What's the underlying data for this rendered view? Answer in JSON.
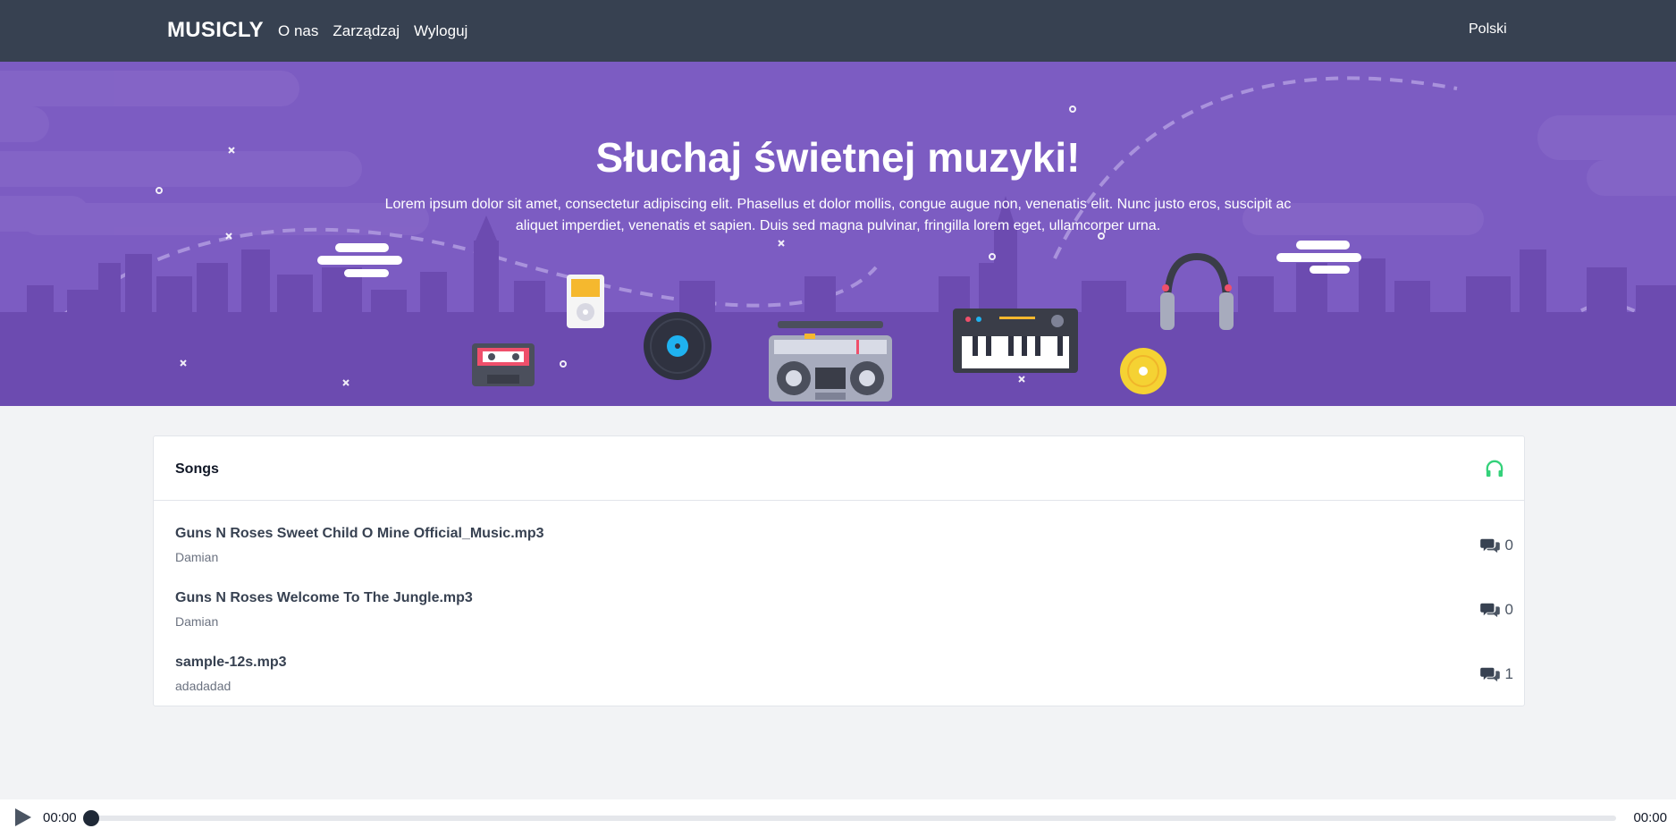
{
  "nav": {
    "brand": "MUSICLY",
    "links": [
      "O nas",
      "Zarządzaj",
      "Wyloguj"
    ],
    "language": "Polski"
  },
  "hero": {
    "title": "Słuchaj świetnej muzyki!",
    "subtitle": "Lorem ipsum dolor sit amet, consectetur adipiscing elit. Phasellus et dolor mollis, congue augue non, venenatis elit. Nunc justo eros, suscipit ac aliquet imperdiet, venenatis et sapien. Duis sed magna pulvinar, fringilla lorem eget, ullamcorper urna."
  },
  "songs": {
    "title": "Songs",
    "header_icon": "headphones-icon",
    "items": [
      {
        "title": "Guns N Roses Sweet Child O Mine Official_Music.mp3",
        "author": "Damian",
        "comments": "0"
      },
      {
        "title": "Guns N Roses Welcome To The Jungle.mp3",
        "author": "Damian",
        "comments": "0"
      },
      {
        "title": "sample-12s.mp3",
        "author": "adadadad",
        "comments": "1"
      }
    ]
  },
  "player": {
    "current_time": "00:00",
    "duration": "00:00",
    "progress": 0
  },
  "colors": {
    "navbar": "#374151",
    "hero": "#7c5cc2",
    "accent_green": "#34d17a"
  }
}
